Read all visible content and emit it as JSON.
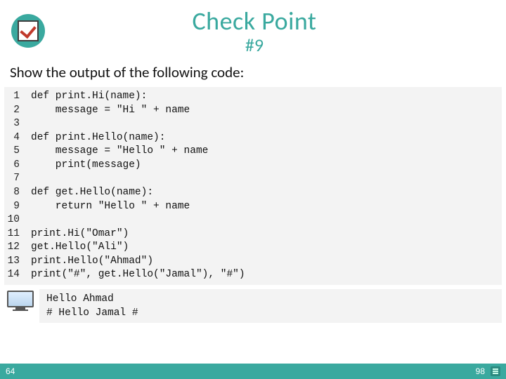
{
  "header": {
    "title_main": "Check Point",
    "title_sub": "#9"
  },
  "prompt": "Show the output of the following code:",
  "code": {
    "line_numbers": [
      "1",
      "2",
      "3",
      "4",
      "5",
      "6",
      "7",
      "8",
      "9",
      "10",
      "11",
      "12",
      "13",
      "14"
    ],
    "lines": [
      "def print.Hi(name):",
      "    message = \"Hi \" + name",
      "",
      "def print.Hello(name):",
      "    message = \"Hello \" + name",
      "    print(message)",
      "",
      "def get.Hello(name):",
      "    return \"Hello \" + name",
      "",
      "print.Hi(\"Omar\")",
      "get.Hello(\"Ali\")",
      "print.Hello(\"Ahmad\")",
      "print(\"#\", get.Hello(\"Jamal\"), \"#\")"
    ]
  },
  "output": {
    "lines": [
      "Hello Ahmad",
      "# Hello Jamal #"
    ]
  },
  "footer": {
    "left": "64",
    "right": "98"
  }
}
